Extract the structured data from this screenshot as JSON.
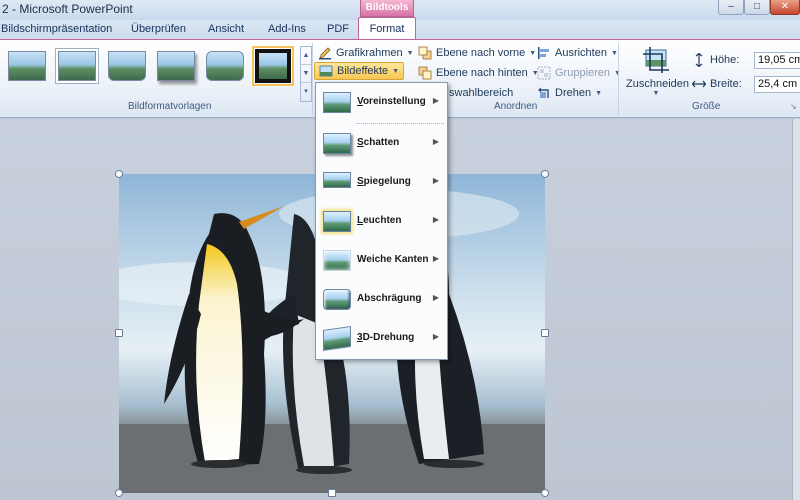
{
  "window": {
    "title": "2 - Microsoft PowerPoint",
    "min": "–",
    "max": "□",
    "close": "✕"
  },
  "contextual_tab": "Bildtools",
  "tabs": [
    "Bildschirmpräsentation",
    "Überprüfen",
    "Ansicht",
    "Add-Ins",
    "PDF"
  ],
  "active_tab": "Format",
  "ribbon": {
    "styles_group_label": "Bildformatvorlagen",
    "grafikrahmen": "Grafikrahmen",
    "bildeffekte": "Bildeffekte",
    "arrange": {
      "ebene_vorne": "Ebene nach vorne",
      "ebene_hinten": "Ebene nach hinten",
      "auswahlbereich": "swahlbereich",
      "ausrichten": "Ausrichten",
      "gruppieren": "Gruppieren",
      "drehen": "Drehen",
      "group_label": "Anordnen"
    },
    "size": {
      "crop": "Zuschneiden",
      "hoehe_label": "Höhe:",
      "hoehe_value": "19,05 cm",
      "breite_label": "Breite:",
      "breite_value": "25,4 cm",
      "group_label": "Größe"
    }
  },
  "bildeffekte_menu": [
    {
      "label": "Voreinstellung",
      "underline": "V",
      "rest": "oreinstellung"
    },
    {
      "label": "Schatten",
      "underline": "S",
      "rest": "chatten"
    },
    {
      "label": "Spiegelung",
      "underline": "S",
      "rest": "piegelung"
    },
    {
      "label": "Leuchten",
      "underline": "L",
      "rest": "euchten"
    },
    {
      "label": "Weiche Kanten",
      "underline": "",
      "rest": "Weiche Kanten"
    },
    {
      "label": "Abschrägung",
      "underline": "",
      "rest": "Abschrägung"
    },
    {
      "label": "3D-Drehung",
      "underline": "3",
      "rest": "D-Drehung"
    }
  ],
  "colors": {
    "accent": "#f8c754",
    "contextual": "#d874a6",
    "ribbon_text": "#1e395b"
  }
}
